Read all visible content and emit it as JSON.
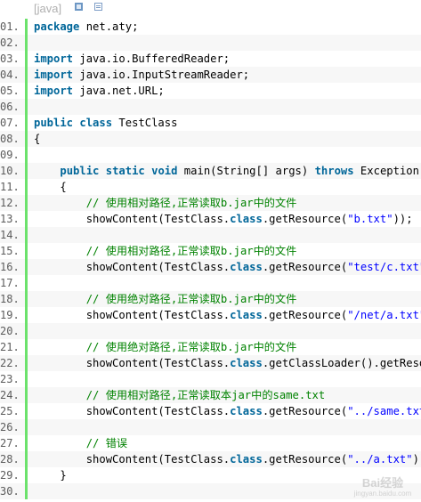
{
  "header": {
    "lang_tag": "[java]",
    "view_icon": "view-plain-icon",
    "copy_icon": "copy-icon"
  },
  "code": {
    "lines": [
      {
        "num": "01.",
        "tokens": [
          {
            "t": "kw",
            "v": "package"
          },
          {
            "t": "plain",
            "v": " net.aty;"
          }
        ]
      },
      {
        "num": "02.",
        "tokens": []
      },
      {
        "num": "03.",
        "tokens": [
          {
            "t": "kw",
            "v": "import"
          },
          {
            "t": "plain",
            "v": " java.io.BufferedReader;"
          }
        ]
      },
      {
        "num": "04.",
        "tokens": [
          {
            "t": "kw",
            "v": "import"
          },
          {
            "t": "plain",
            "v": " java.io.InputStreamReader;"
          }
        ]
      },
      {
        "num": "05.",
        "tokens": [
          {
            "t": "kw",
            "v": "import"
          },
          {
            "t": "plain",
            "v": " java.net.URL;"
          }
        ]
      },
      {
        "num": "06.",
        "tokens": []
      },
      {
        "num": "07.",
        "tokens": [
          {
            "t": "kw",
            "v": "public"
          },
          {
            "t": "plain",
            "v": " "
          },
          {
            "t": "kw",
            "v": "class"
          },
          {
            "t": "plain",
            "v": " TestClass"
          }
        ]
      },
      {
        "num": "08.",
        "tokens": [
          {
            "t": "plain",
            "v": "{"
          }
        ]
      },
      {
        "num": "09.",
        "tokens": []
      },
      {
        "num": "10.",
        "tokens": [
          {
            "t": "plain",
            "v": "    "
          },
          {
            "t": "kw",
            "v": "public"
          },
          {
            "t": "plain",
            "v": " "
          },
          {
            "t": "kw",
            "v": "static"
          },
          {
            "t": "plain",
            "v": " "
          },
          {
            "t": "kw",
            "v": "void"
          },
          {
            "t": "plain",
            "v": " main(String[] args) "
          },
          {
            "t": "kw",
            "v": "throws"
          },
          {
            "t": "plain",
            "v": " Exception"
          }
        ]
      },
      {
        "num": "11.",
        "tokens": [
          {
            "t": "plain",
            "v": "    {"
          }
        ]
      },
      {
        "num": "12.",
        "tokens": [
          {
            "t": "plain",
            "v": "        "
          },
          {
            "t": "cm",
            "v": "// 使用相对路径,正常读取b.jar中的文件"
          }
        ]
      },
      {
        "num": "13.",
        "tokens": [
          {
            "t": "plain",
            "v": "        showContent(TestClass."
          },
          {
            "t": "kw",
            "v": "class"
          },
          {
            "t": "plain",
            "v": ".getResource("
          },
          {
            "t": "str",
            "v": "\"b.txt\""
          },
          {
            "t": "plain",
            "v": "));"
          }
        ]
      },
      {
        "num": "14.",
        "tokens": []
      },
      {
        "num": "15.",
        "tokens": [
          {
            "t": "plain",
            "v": "        "
          },
          {
            "t": "cm",
            "v": "// 使用相对路径,正常读取b.jar中的文件"
          }
        ]
      },
      {
        "num": "16.",
        "tokens": [
          {
            "t": "plain",
            "v": "        showContent(TestClass."
          },
          {
            "t": "kw",
            "v": "class"
          },
          {
            "t": "plain",
            "v": ".getResource("
          },
          {
            "t": "str",
            "v": "\"test/c.txt\""
          },
          {
            "t": "plain",
            "v": "));"
          }
        ]
      },
      {
        "num": "17.",
        "tokens": []
      },
      {
        "num": "18.",
        "tokens": [
          {
            "t": "plain",
            "v": "        "
          },
          {
            "t": "cm",
            "v": "// 使用绝对路径,正常读取b.jar中的文件"
          }
        ]
      },
      {
        "num": "19.",
        "tokens": [
          {
            "t": "plain",
            "v": "        showContent(TestClass."
          },
          {
            "t": "kw",
            "v": "class"
          },
          {
            "t": "plain",
            "v": ".getResource("
          },
          {
            "t": "str",
            "v": "\"/net/a.txt\""
          },
          {
            "t": "plain",
            "v": "));"
          }
        ]
      },
      {
        "num": "20.",
        "tokens": []
      },
      {
        "num": "21.",
        "tokens": [
          {
            "t": "plain",
            "v": "        "
          },
          {
            "t": "cm",
            "v": "// 使用绝对路径,正常读取b.jar中的文件"
          }
        ]
      },
      {
        "num": "22.",
        "tokens": [
          {
            "t": "plain",
            "v": "        showContent(TestClass."
          },
          {
            "t": "kw",
            "v": "class"
          },
          {
            "t": "plain",
            "v": ".getClassLoader().getResource("
          }
        ]
      },
      {
        "num": "23.",
        "tokens": []
      },
      {
        "num": "24.",
        "tokens": [
          {
            "t": "plain",
            "v": "        "
          },
          {
            "t": "cm",
            "v": "// 使用相对路径,正常读取本jar中的same.txt"
          }
        ]
      },
      {
        "num": "25.",
        "tokens": [
          {
            "t": "plain",
            "v": "        showContent(TestClass."
          },
          {
            "t": "kw",
            "v": "class"
          },
          {
            "t": "plain",
            "v": ".getResource("
          },
          {
            "t": "str",
            "v": "\"../same.txt\""
          },
          {
            "t": "plain",
            "v": "));"
          }
        ]
      },
      {
        "num": "26.",
        "tokens": []
      },
      {
        "num": "27.",
        "tokens": [
          {
            "t": "plain",
            "v": "        "
          },
          {
            "t": "cm",
            "v": "// 错误"
          }
        ]
      },
      {
        "num": "28.",
        "tokens": [
          {
            "t": "plain",
            "v": "        showContent(TestClass."
          },
          {
            "t": "kw",
            "v": "class"
          },
          {
            "t": "plain",
            "v": ".getResource("
          },
          {
            "t": "str",
            "v": "\"../a.txt\""
          },
          {
            "t": "plain",
            "v": "));"
          }
        ]
      },
      {
        "num": "29.",
        "tokens": [
          {
            "t": "plain",
            "v": "    }"
          }
        ]
      },
      {
        "num": "30.",
        "tokens": []
      }
    ]
  },
  "watermark": {
    "text": "Bai经验",
    "sub": "jingyan.baidu.com"
  },
  "colors": {
    "keyword": "#006699",
    "string": "#0000ff",
    "comment": "#008200",
    "gutter_bar": "#6ce26c"
  }
}
